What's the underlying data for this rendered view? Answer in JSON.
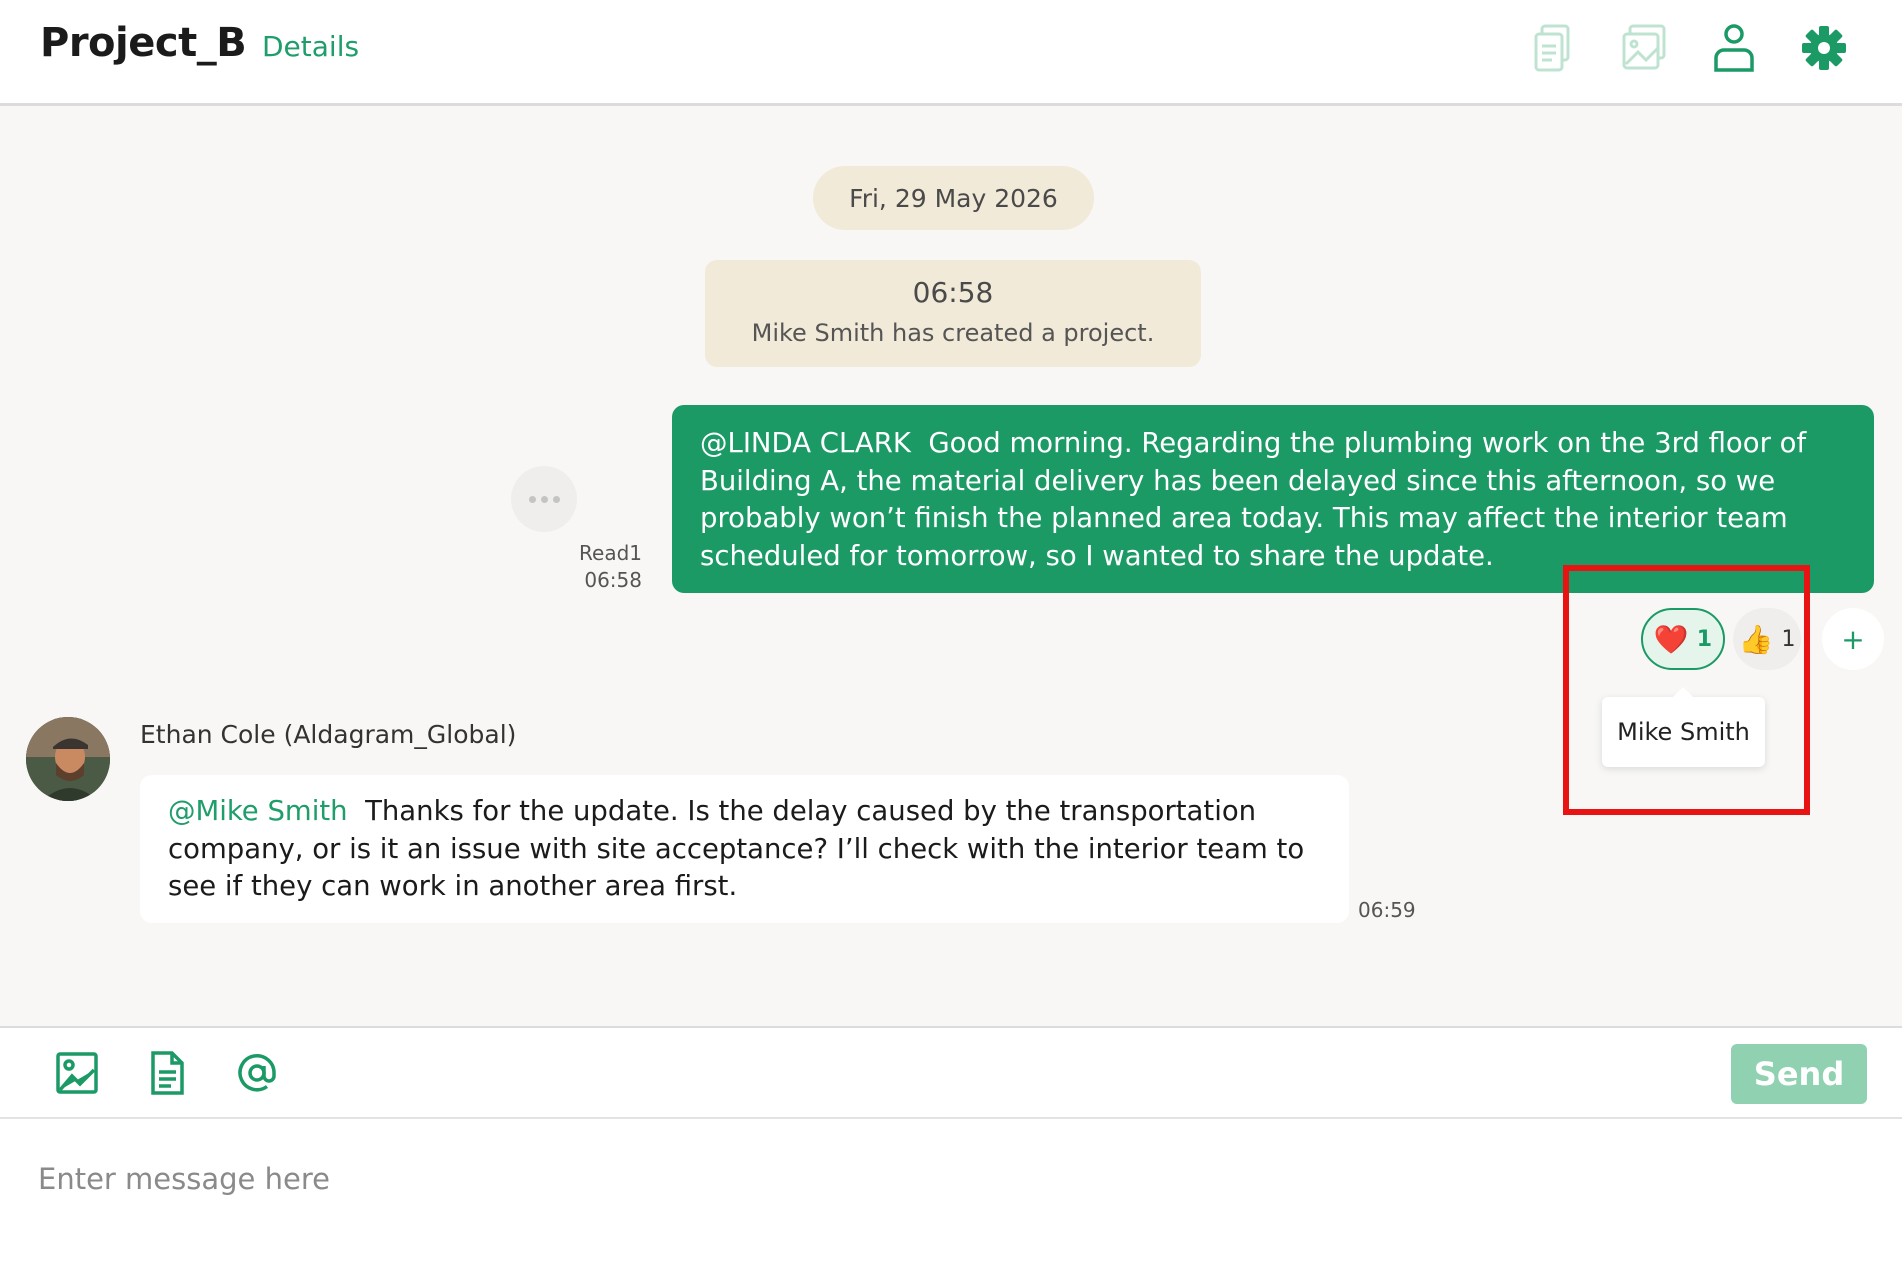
{
  "header": {
    "title": "Project_B",
    "details_label": "Details",
    "icons": [
      "files-icon",
      "images-icon",
      "members-icon",
      "settings-icon"
    ]
  },
  "chat": {
    "date_label": "Fri, 29 May 2026",
    "system_message": {
      "time": "06:58",
      "text": "Mike Smith has created a project."
    },
    "my_message": {
      "mention": "@LINDA CLARK",
      "text": "Good morning. Regarding the plumbing work on the 3rd floor of Building A, the material delivery has been delayed since this afternoon, so we probably won’t finish the planned area today. This may affect the interior team scheduled for tomorrow, so I wanted to share the update.",
      "read_label": "Read1",
      "time": "06:58",
      "reactions": [
        {
          "emoji": "❤️",
          "count": "1",
          "selected": true
        },
        {
          "emoji": "👍",
          "count": "1",
          "selected": false
        }
      ],
      "add_reaction_label": "+",
      "tooltip": "Mike Smith"
    },
    "other_message": {
      "sender": "Ethan Cole (Aldagram_Global)",
      "mention": "@Mike Smith",
      "text": "Thanks for the update. Is the delay caused by the transportation company, or is it an issue with site acceptance? I’ll check with the interior team to see if they can work in another area first.",
      "time": "06:59"
    }
  },
  "composer": {
    "icons": [
      "image-icon",
      "file-icon",
      "mention-icon"
    ],
    "send_label": "Send",
    "placeholder": "Enter message here"
  },
  "colors": {
    "accent": "#1b9a66",
    "accent_light": "#8fd1b0",
    "system_bg": "#f2ead8",
    "highlight": "#e81313"
  }
}
